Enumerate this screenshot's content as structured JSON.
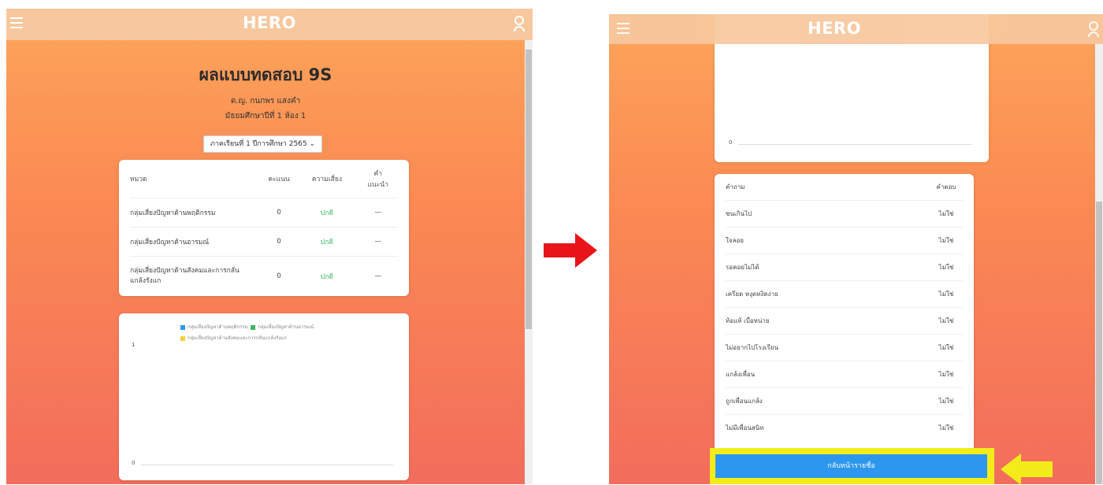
{
  "left": {
    "brand": "HERO",
    "title": "ผลแบบทดสอบ 9S",
    "student_name": "ด.ญ. กนกพร แสงคำ",
    "student_class": "มัธยมศึกษาปีที่ 1 ห้อง 1",
    "term_select": "ภาคเรียนที่ 1 ปีการศึกษา 2565",
    "table": {
      "headers": {
        "category": "หมวด",
        "score": "คะแนน",
        "risk": "ความเสี่ยง",
        "advice": "คำแนะนำ"
      },
      "rows": [
        {
          "category": "กลุ่มเสี่ยงปัญหาด้านพฤติกรรม",
          "score": "0",
          "risk": "ปกติ",
          "advice": "—"
        },
        {
          "category": "กลุ่มเสี่ยงปัญหาด้านอารมณ์",
          "score": "0",
          "risk": "ปกติ",
          "advice": "—"
        },
        {
          "category": "กลุ่มเสี่ยงปัญหาด้านสังคมและการกลั่นแกล้งรังแก",
          "score": "0",
          "risk": "ปกติ",
          "advice": "—"
        }
      ]
    },
    "chart": {
      "legend": [
        "กลุ่มเสี่ยงปัญหาด้านพฤติกรรม",
        "กลุ่มเสี่ยงปัญหาด้านอารมณ์",
        "กลุ่มเสี่ยงปัญหาด้านสังคมและการกลั่นแกล้งรังแก"
      ],
      "legend_colors": [
        "#2d97ed",
        "#3bb85f",
        "#f2cf3c"
      ],
      "y_top": "1",
      "y_bottom": "0"
    }
  },
  "right": {
    "brand": "HERO",
    "chart": {
      "y_bottom": "0"
    },
    "qa": {
      "header_question": "คำถาม",
      "header_answer": "คำตอบ",
      "rows": [
        {
          "q": "ซนเกินไป",
          "a": "ไม่ใช่"
        },
        {
          "q": "ใจลอย",
          "a": "ไม่ใช่"
        },
        {
          "q": "รอคอยไม่ได้",
          "a": "ไม่ใช่"
        },
        {
          "q": "เครียด หงุดหงิดง่าย",
          "a": "ไม่ใช่"
        },
        {
          "q": "ท้อแท้ เบื่อหน่าย",
          "a": "ไม่ใช่"
        },
        {
          "q": "ไม่อยากไปโรงเรียน",
          "a": "ไม่ใช่"
        },
        {
          "q": "แกล้งเพื่อน",
          "a": "ไม่ใช่"
        },
        {
          "q": "ถูกเพื่อนแกล้ง",
          "a": "ไม่ใช่"
        },
        {
          "q": "ไม่มีเพื่อนสนิท",
          "a": "ไม่ใช่"
        }
      ]
    },
    "back_button": "กลับหน้ารายชื่อ"
  },
  "colors": {
    "arrow_red": "#e8141a",
    "arrow_yellow": "#f4ec1a",
    "button_blue": "#2d97ed"
  }
}
